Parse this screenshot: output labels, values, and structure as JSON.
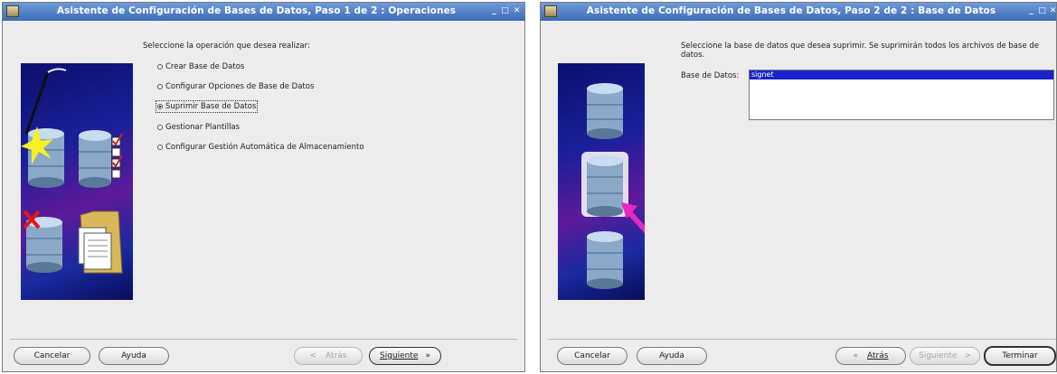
{
  "window1": {
    "title": "Asistente de Configuración de Bases de Datos, Paso 1 de 2 : Operaciones",
    "minimize": "_",
    "maximize": "□",
    "close": "✕",
    "prompt": "Seleccione la operación que desea realizar:",
    "options": [
      {
        "label": "Crear Base de Datos",
        "selected": false
      },
      {
        "label": "Configurar Opciones de Base de Datos",
        "selected": false
      },
      {
        "label": "Suprimir Base de Datos",
        "selected": true
      },
      {
        "label": "Gestionar Plantillas",
        "selected": false
      },
      {
        "label": "Configurar Gestión Automática de Almacenamiento",
        "selected": false
      }
    ],
    "buttons": {
      "cancel": "Cancelar",
      "help": "Ayuda",
      "back": "Atrás",
      "back_arrow": "<",
      "next": "Siguiente",
      "next_arrow": "»"
    }
  },
  "window2": {
    "title": "Asistente de Configuración de Bases de Datos, Paso 2 de 2 : Base de Datos",
    "minimize": "_",
    "maximize": "□",
    "close": "✕",
    "prompt": "Seleccione la base de datos que desea suprimir. Se suprimirán todos los archivos de base de datos.",
    "db_label": "Base de Datos:",
    "databases": [
      "signet"
    ],
    "buttons": {
      "cancel": "Cancelar",
      "help": "Ayuda",
      "back_arrow": "«",
      "back": "Atrás",
      "next": "Siguiente",
      "next_arrow": ">",
      "finish": "Terminar"
    }
  },
  "colors": {
    "titlebar": "#4a7bc8",
    "selection": "#1a23c8",
    "graphic_bg": "#1a1f9a"
  }
}
